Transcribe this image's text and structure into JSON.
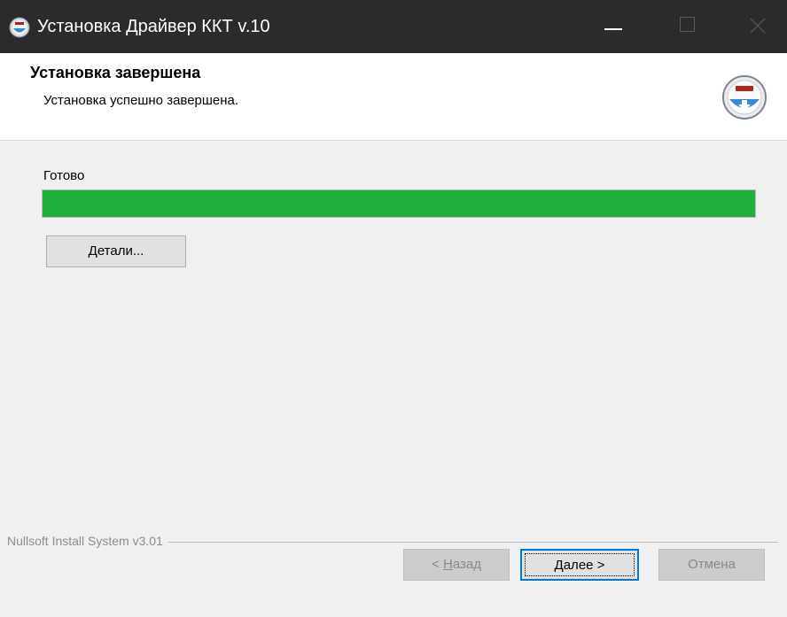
{
  "window": {
    "title": "Установка Драйвер ККТ v.10",
    "icon": "installer-disc-icon"
  },
  "header": {
    "title": "Установка завершена",
    "subtitle": "Установка успешно завершена.",
    "icon": "installer-disc-icon"
  },
  "main": {
    "status": "Готово",
    "progress": 1.0,
    "progress_color": "#1faf3a",
    "details_button": "Детали..."
  },
  "footer": {
    "brand": "Nullsoft Install System v3.01",
    "back": {
      "underline": "Н",
      "rest": "азад",
      "prefix": "< "
    },
    "next": {
      "underline": "Д",
      "rest": "алее >"
    },
    "cancel": "Отмена"
  }
}
